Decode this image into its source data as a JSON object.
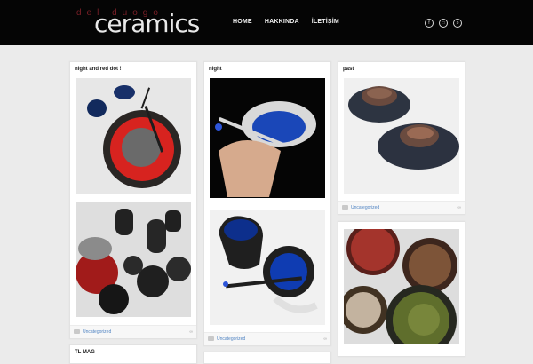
{
  "logo": {
    "subtext": "del duogo",
    "main": "ceramics"
  },
  "nav": {
    "home": "HOME",
    "about": "HAKKINDA",
    "contact": "İLETİŞİM"
  },
  "social": {
    "facebook": "facebook-icon",
    "instagram": "instagram-icon",
    "pinterest": "pinterest-icon"
  },
  "posts": [
    {
      "title": "night and red dot !",
      "category": "Uncategorized"
    },
    {
      "title": "night",
      "category": "Uncategorized"
    },
    {
      "title": "past",
      "category": "Uncategorized"
    },
    {
      "title": "TL MAG"
    }
  ],
  "colors": {
    "header": "#050505",
    "background": "#ebebeb",
    "link": "#4f83c2"
  }
}
